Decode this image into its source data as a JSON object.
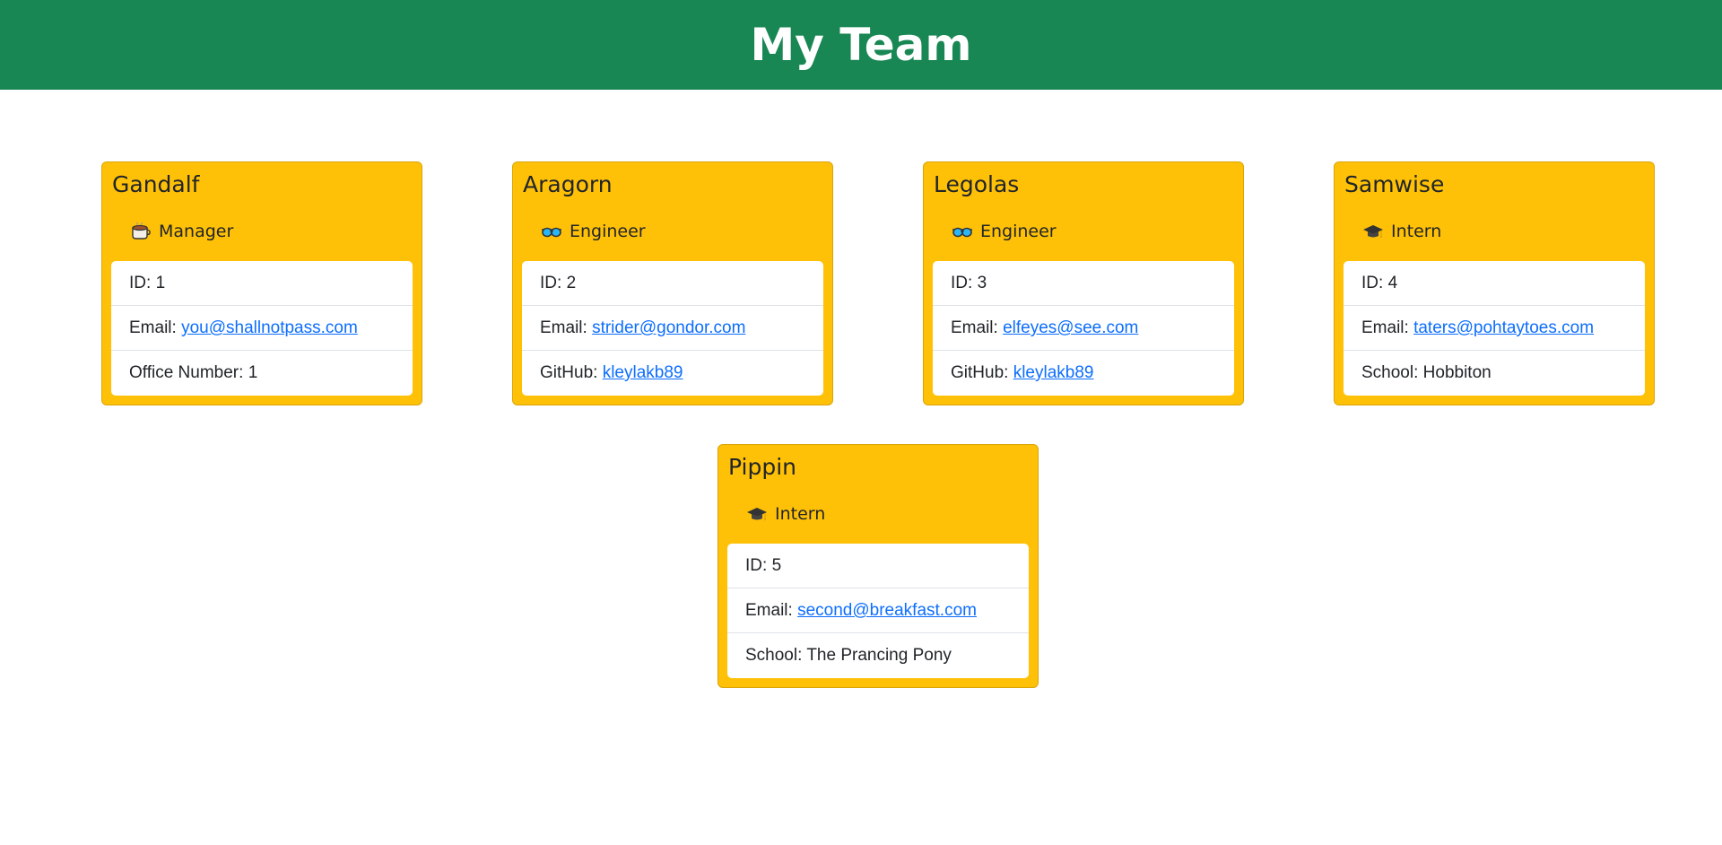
{
  "header": {
    "title": "My Team"
  },
  "cards": [
    {
      "name": "Gandalf",
      "role": "Manager",
      "icon": "coffee-mug-icon",
      "id_label": "ID:",
      "id": "1",
      "email_label": "Email:",
      "email": "you@shallnotpass.com",
      "extra_label": "Office Number:",
      "extra": "1"
    },
    {
      "name": "Aragorn",
      "role": "Engineer",
      "icon": "goggles-icon",
      "id_label": "ID:",
      "id": "2",
      "email_label": "Email:",
      "email": "strider@gondor.com",
      "extra_label": "GitHub:",
      "extra": "kleylakb89"
    },
    {
      "name": "Legolas",
      "role": "Engineer",
      "icon": "goggles-icon",
      "id_label": "ID:",
      "id": "3",
      "email_label": "Email:",
      "email": "elfeyes@see.com",
      "extra_label": "GitHub:",
      "extra": "kleylakb89"
    },
    {
      "name": "Samwise",
      "role": "Intern",
      "icon": "graduation-cap-icon",
      "id_label": "ID:",
      "id": "4",
      "email_label": "Email:",
      "email": "taters@pohtaytoes.com",
      "extra_label": "School:",
      "extra": "Hobbiton"
    },
    {
      "name": "Pippin",
      "role": "Intern",
      "icon": "graduation-cap-icon",
      "id_label": "ID:",
      "id": "5",
      "email_label": "Email:",
      "email": "second@breakfast.com",
      "extra_label": "School:",
      "extra": "The Prancing Pony"
    }
  ],
  "colors": {
    "header_bg": "#198754",
    "card_bg": "#ffc107",
    "link": "#0d6efd"
  }
}
